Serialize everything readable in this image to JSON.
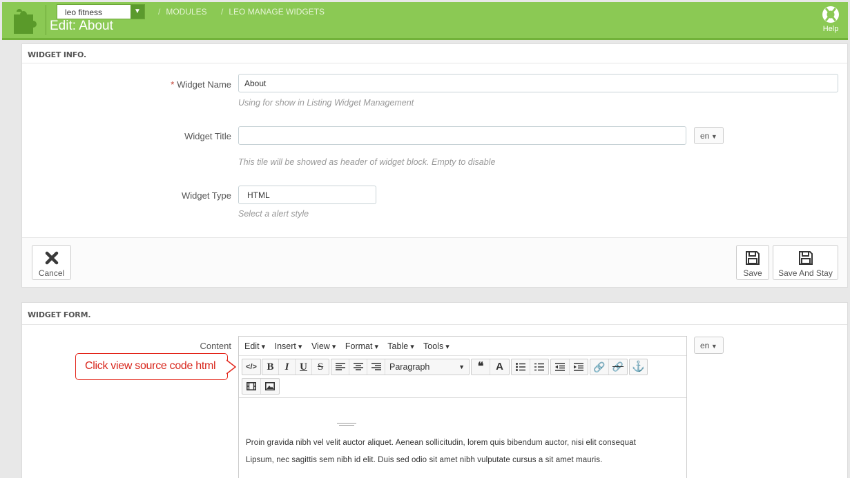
{
  "header": {
    "shop_select": "leo fitness",
    "breadcrumb": [
      "MODULES",
      "LEO MANAGE WIDGETS"
    ],
    "title": "Edit: About",
    "help_label": "Help"
  },
  "widget_info": {
    "heading": "WIDGET INFO.",
    "name_label": "Widget Name",
    "name_value": "About",
    "name_hint": "Using for show in Listing Widget Management",
    "title_label": "Widget Title",
    "title_value": "",
    "title_hint": "This tile will be showed as header of widget block. Empty to disable",
    "lang": "en",
    "type_label": "Widget Type",
    "type_value": "HTML",
    "type_hint": "Select a alert style",
    "cancel_label": "Cancel",
    "save_label": "Save",
    "save_stay_label": "Save And Stay"
  },
  "widget_form": {
    "heading": "WIDGET FORM.",
    "content_label": "Content",
    "lang": "en",
    "menus": [
      "Edit",
      "Insert",
      "View",
      "Format",
      "Table",
      "Tools"
    ],
    "block_format": "Paragraph",
    "content_lines": [
      "Proin gravida nibh vel velit auctor aliquet. Aenean sollicitudin, lorem quis bibendum auctor, nisi elit consequat",
      "Lipsum, nec sagittis sem nibh id elit. Duis sed odio sit amet nibh vulputate cursus a sit amet mauris."
    ]
  },
  "callout": {
    "text": "Click view source code html"
  },
  "colors": {
    "header_green": "#8bc954",
    "callout_red": "#e3261b"
  }
}
